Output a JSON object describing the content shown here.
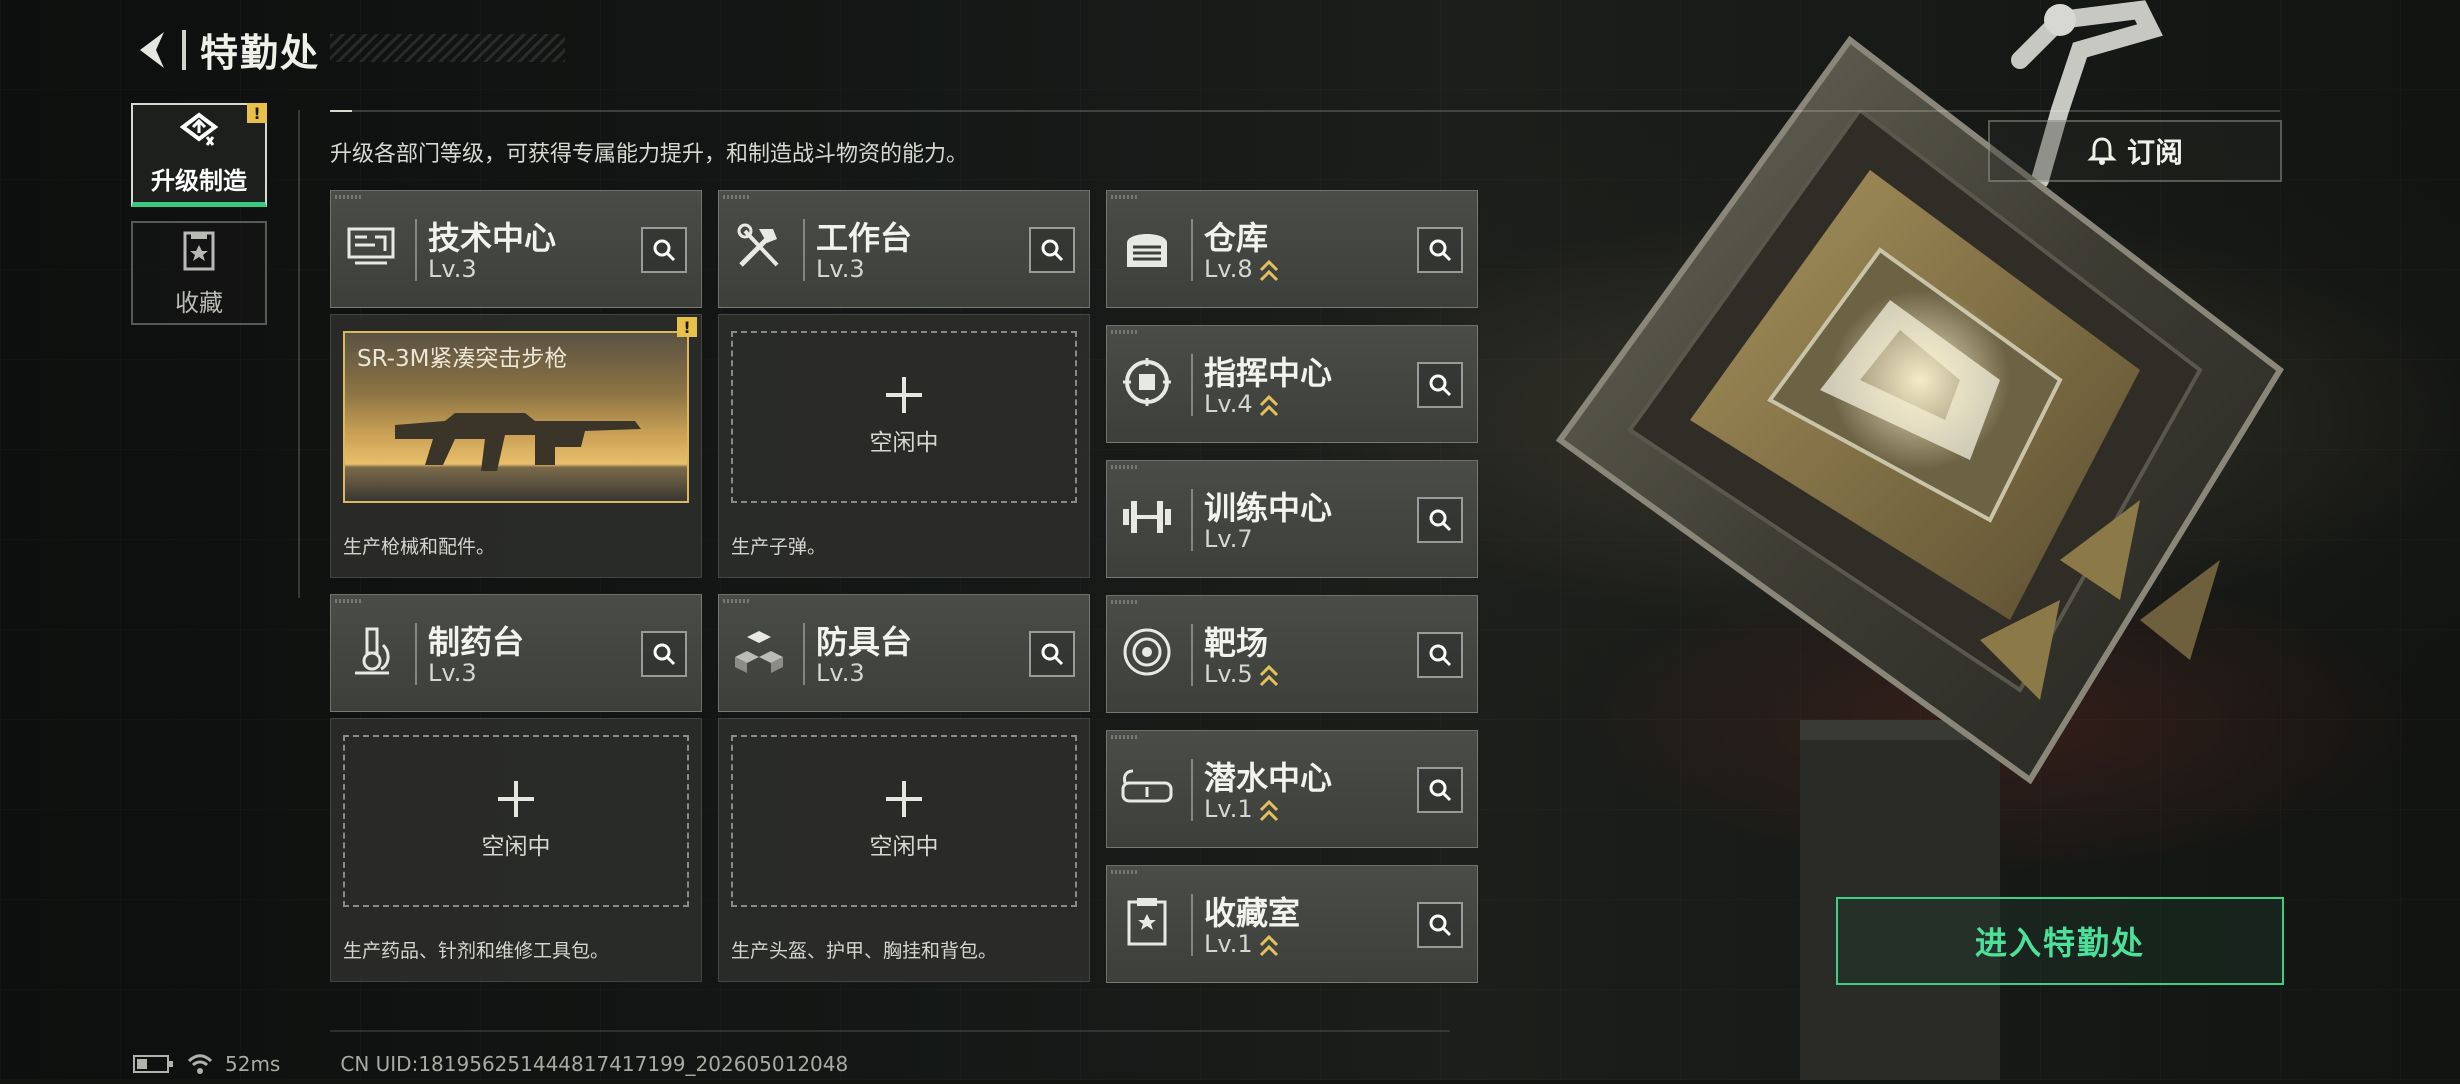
{
  "header": {
    "title": "特勤处",
    "back_icon": "chevron-left-icon"
  },
  "left_nav": {
    "items": [
      {
        "label": "升级制造",
        "icon": "upgrade-icon",
        "active": true,
        "alert": "!"
      },
      {
        "label": "收藏",
        "icon": "collection-icon",
        "active": false
      }
    ]
  },
  "intro": "升级各部门等级，可获得专属能力提升，和制造战斗物资的能力。",
  "subscribe": {
    "label": "订阅",
    "icon": "bell-icon"
  },
  "modules": {
    "tech_center": {
      "name": "技术中心",
      "level": "Lv.3",
      "icon": "circuit-icon"
    },
    "workbench": {
      "name": "工作台",
      "level": "Lv.3",
      "icon": "hammer-wrench-icon"
    },
    "pharmacy": {
      "name": "制药台",
      "level": "Lv.3",
      "icon": "microscope-icon"
    },
    "armory": {
      "name": "防具台",
      "level": "Lv.3",
      "icon": "cubes-icon"
    },
    "warehouse": {
      "name": "仓库",
      "level": "Lv.8",
      "icon": "warehouse-icon",
      "upgradable": true
    },
    "command_center": {
      "name": "指挥中心",
      "level": "Lv.4",
      "icon": "chip-icon",
      "upgradable": true
    },
    "training_center": {
      "name": "训练中心",
      "level": "Lv.7",
      "icon": "dumbbell-icon",
      "upgradable": false
    },
    "shooting_range": {
      "name": "靶场",
      "level": "Lv.5",
      "icon": "target-icon",
      "upgradable": true
    },
    "diving_center": {
      "name": "潜水中心",
      "level": "Lv.1",
      "icon": "dive-mask-icon",
      "upgradable": true
    },
    "collection_room": {
      "name": "收藏室",
      "level": "Lv.1",
      "icon": "trophy-icon",
      "upgradable": true
    }
  },
  "production": {
    "tech_center": {
      "item_name": "SR-3M紧凑突击步枪",
      "alert": "!",
      "desc": "生产枪械和配件。"
    },
    "workbench": {
      "slot_label": "空闲中",
      "desc": "生产子弹。"
    },
    "pharmacy": {
      "slot_label": "空闲中",
      "desc": "生产药品、针剂和维修工具包。"
    },
    "armory": {
      "slot_label": "空闲中",
      "desc": "生产头盔、护甲、胸挂和背包。"
    }
  },
  "enter_button": {
    "label": "进入特勤处"
  },
  "footer": {
    "ping": "52ms",
    "uid": "CN UID:181956251444817417199_202605012048"
  },
  "colors": {
    "accent_green": "#3fce86",
    "alert_yellow": "#e8c14a",
    "upgrade_gold": "#e2c15c"
  }
}
